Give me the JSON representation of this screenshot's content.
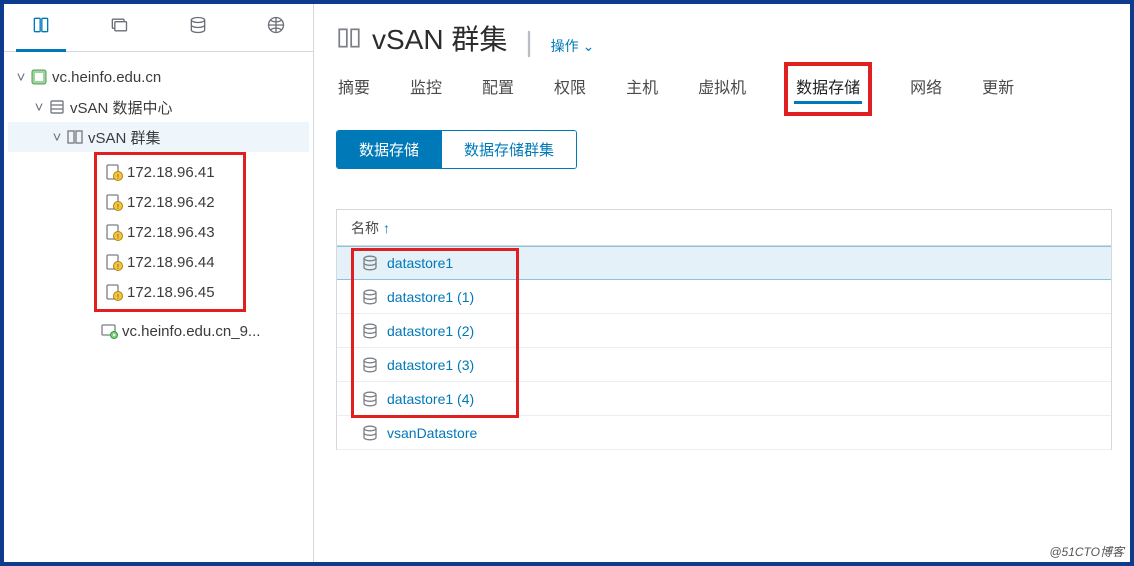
{
  "sidebar": {
    "root": {
      "label": "vc.heinfo.edu.cn"
    },
    "dc": {
      "label": "vSAN 数据中心"
    },
    "cluster": {
      "label": "vSAN 群集"
    },
    "hosts": [
      {
        "label": "172.18.96.41"
      },
      {
        "label": "172.18.96.42"
      },
      {
        "label": "172.18.96.43"
      },
      {
        "label": "172.18.96.44"
      },
      {
        "label": "172.18.96.45"
      }
    ],
    "vm": {
      "label": "vc.heinfo.edu.cn_9..."
    }
  },
  "header": {
    "title": "vSAN 群集",
    "actions": "操作"
  },
  "tabs": [
    {
      "label": "摘要"
    },
    {
      "label": "监控"
    },
    {
      "label": "配置"
    },
    {
      "label": "权限"
    },
    {
      "label": "主机"
    },
    {
      "label": "虚拟机"
    },
    {
      "label": "数据存储",
      "active": true
    },
    {
      "label": "网络"
    },
    {
      "label": "更新"
    }
  ],
  "subtabs": [
    {
      "label": "数据存储",
      "active": true
    },
    {
      "label": "数据存储群集"
    }
  ],
  "table": {
    "column": "名称",
    "rows": [
      {
        "label": "datastore1",
        "selected": true
      },
      {
        "label": "datastore1 (1)"
      },
      {
        "label": "datastore1 (2)"
      },
      {
        "label": "datastore1 (3)"
      },
      {
        "label": "datastore1 (4)"
      },
      {
        "label": "vsanDatastore"
      }
    ]
  },
  "watermark": "@51CTO博客",
  "colors": {
    "accent": "#0079b8",
    "frame": "#0e3b8e",
    "highlight": "#e02020"
  }
}
